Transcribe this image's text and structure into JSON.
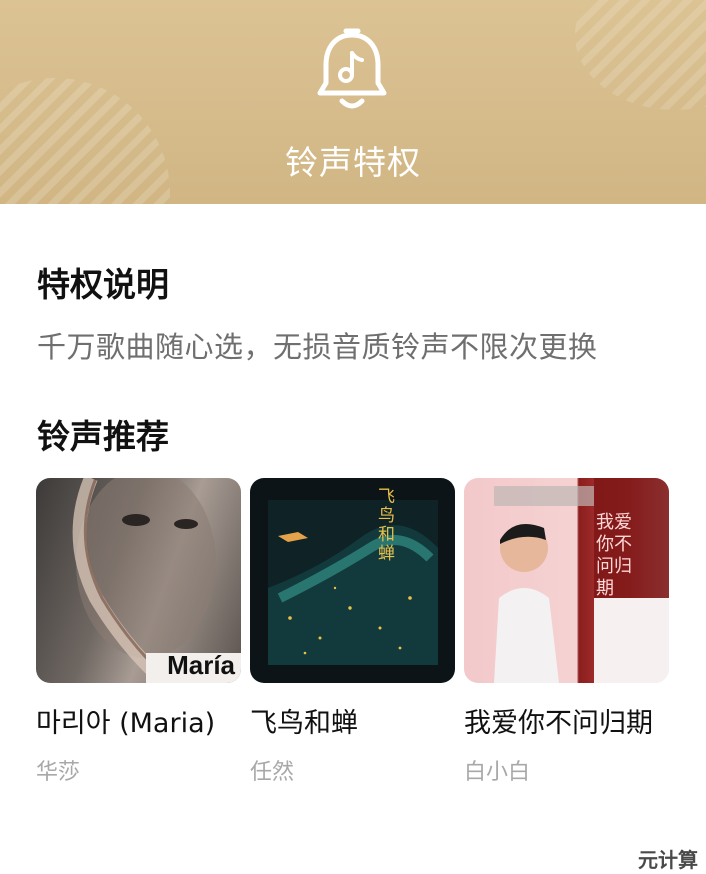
{
  "header": {
    "title": "铃声特权",
    "icon": "bell-music-icon"
  },
  "privilege": {
    "title": "特权说明",
    "description": "千万歌曲随心选，无损音质铃声不限次更换"
  },
  "recommend": {
    "title": "铃声推荐",
    "items": [
      {
        "song": "마리아 (Maria)",
        "artist": "华莎",
        "cover_text": "María"
      },
      {
        "song": "飞鸟和蝉",
        "artist": "任然",
        "cover_text": "飞鸟和蝉"
      },
      {
        "song": "我爱你不问归期",
        "artist": "白小白",
        "cover_text": "我爱你不问归期"
      }
    ]
  },
  "watermark": "元计算",
  "colors": {
    "header_bg": "#d6bd8c",
    "text_primary": "#111111",
    "text_secondary": "#6f6f6f",
    "text_tertiary": "#a8a8a8"
  }
}
